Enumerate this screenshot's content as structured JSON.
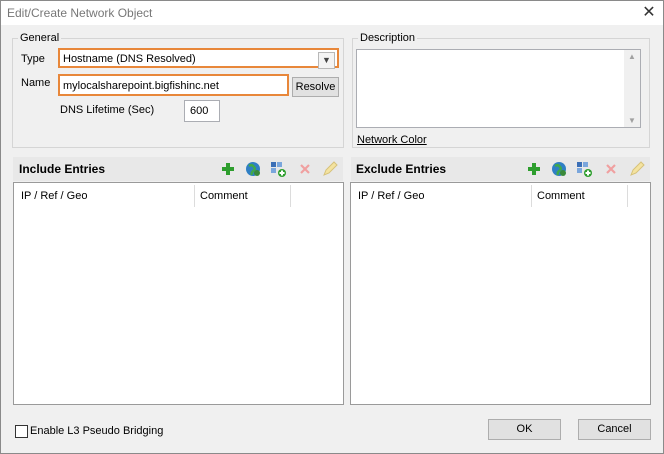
{
  "window": {
    "title": "Edit/Create Network Object",
    "close_glyph": "✕"
  },
  "general": {
    "legend": "General",
    "type_label": "Type",
    "type_value": "Hostname (DNS Resolved)",
    "name_label": "Name",
    "name_value": "mylocalsharepoint.bigfishinc.net",
    "resolve_label": "Resolve",
    "dns_label": "DNS Lifetime (Sec)",
    "dns_value": "600"
  },
  "description": {
    "legend": "Description",
    "network_color_label": "Network Color"
  },
  "include": {
    "title": "Include Entries",
    "columns": [
      "IP / Ref / Geo",
      "Comment"
    ],
    "icons": [
      "add-icon",
      "globe-icon",
      "add-reference-icon",
      "delete-icon",
      "edit-icon"
    ]
  },
  "exclude": {
    "title": "Exclude Entries",
    "columns": [
      "IP / Ref / Geo",
      "Comment"
    ],
    "icons": [
      "add-icon",
      "globe-icon",
      "add-reference-icon",
      "delete-icon",
      "edit-icon"
    ]
  },
  "footer": {
    "bridging_label": "Enable L3 Pseudo Bridging",
    "bridging_checked": false,
    "ok_label": "OK",
    "cancel_label": "Cancel"
  },
  "colors": {
    "accent_focus": "#e8873a",
    "toolbar_bg": "#e8e8e8",
    "add_green": "#2e9e2e",
    "delete_red": "#e05a5a"
  }
}
